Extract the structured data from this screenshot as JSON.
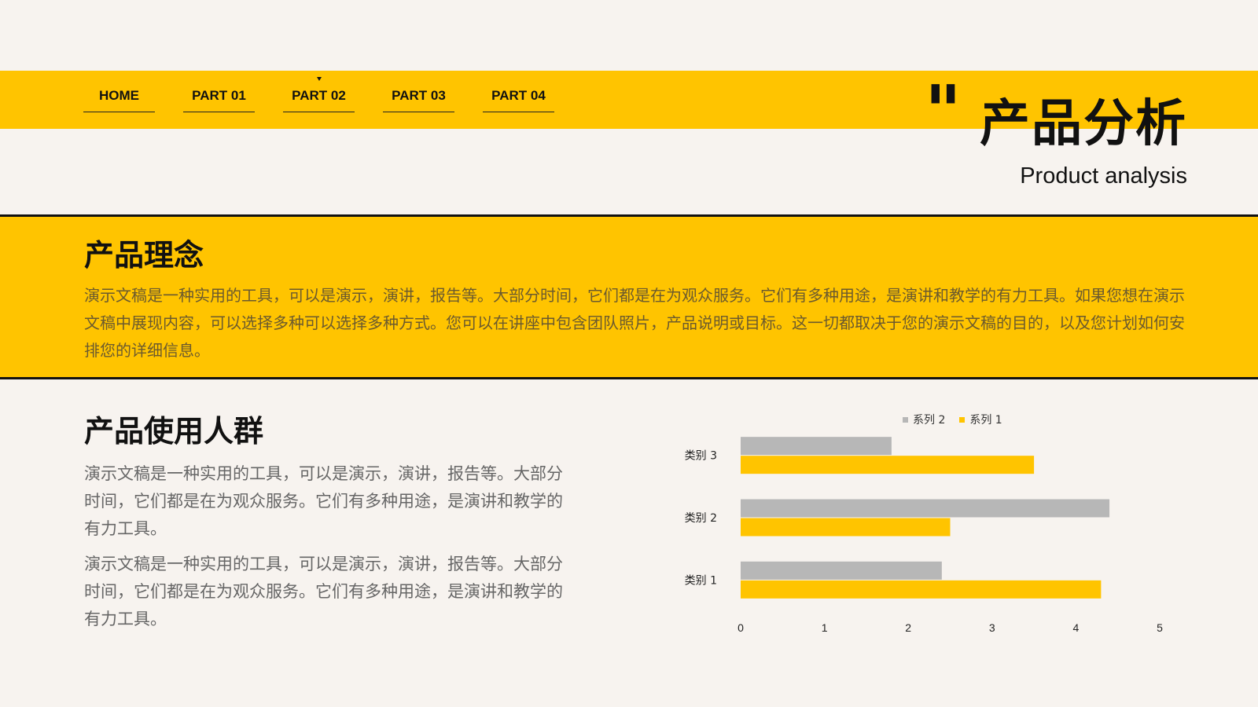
{
  "nav": {
    "items": [
      {
        "label": "HOME"
      },
      {
        "label": "PART 01"
      },
      {
        "label": "PART 02",
        "active": true
      },
      {
        "label": "PART 03"
      },
      {
        "label": "PART 04"
      }
    ]
  },
  "header": {
    "quote_mark": "\"",
    "title_cn": "产品分析",
    "title_en": "Product analysis"
  },
  "concept": {
    "heading": "产品理念",
    "body": "演示文稿是一种实用的工具，可以是演示，演讲，报告等。大部分时间，它们都是在为观众服务。它们有多种用途，是演讲和教学的有力工具。如果您想在演示文稿中展现内容，可以选择多种可以选择多种方式。您可以在讲座中包含团队照片，产品说明或目标。这一切都取决于您的演示文稿的目的，以及您计划如何安排您的详细信息。"
  },
  "audience": {
    "heading": "产品使用人群",
    "paragraphs": [
      "演示文稿是一种实用的工具，可以是演示，演讲，报告等。大部分时间，它们都是在为观众服务。它们有多种用途，是演讲和教学的有力工具。",
      "演示文稿是一种实用的工具，可以是演示，演讲，报告等。大部分时间，它们都是在为观众服务。它们有多种用途，是演讲和教学的有力工具。"
    ]
  },
  "colors": {
    "accent": "#ffc400",
    "series1": "#ffc400",
    "series2": "#b7b7b7"
  },
  "chart_data": {
    "type": "bar",
    "orientation": "horizontal",
    "categories": [
      "类别 1",
      "类别 2",
      "类别 3"
    ],
    "series": [
      {
        "name": "系列 1",
        "values": [
          4.3,
          2.5,
          3.5
        ],
        "color": "#ffc400"
      },
      {
        "name": "系列 2",
        "values": [
          2.4,
          4.4,
          1.8
        ],
        "color": "#b7b7b7"
      }
    ],
    "xlim": [
      0,
      5
    ],
    "xticks": [
      "0",
      "1",
      "2",
      "3",
      "4",
      "5"
    ],
    "legend": {
      "position": "top",
      "order": [
        "系列 2",
        "系列 1"
      ]
    },
    "grid": false
  }
}
